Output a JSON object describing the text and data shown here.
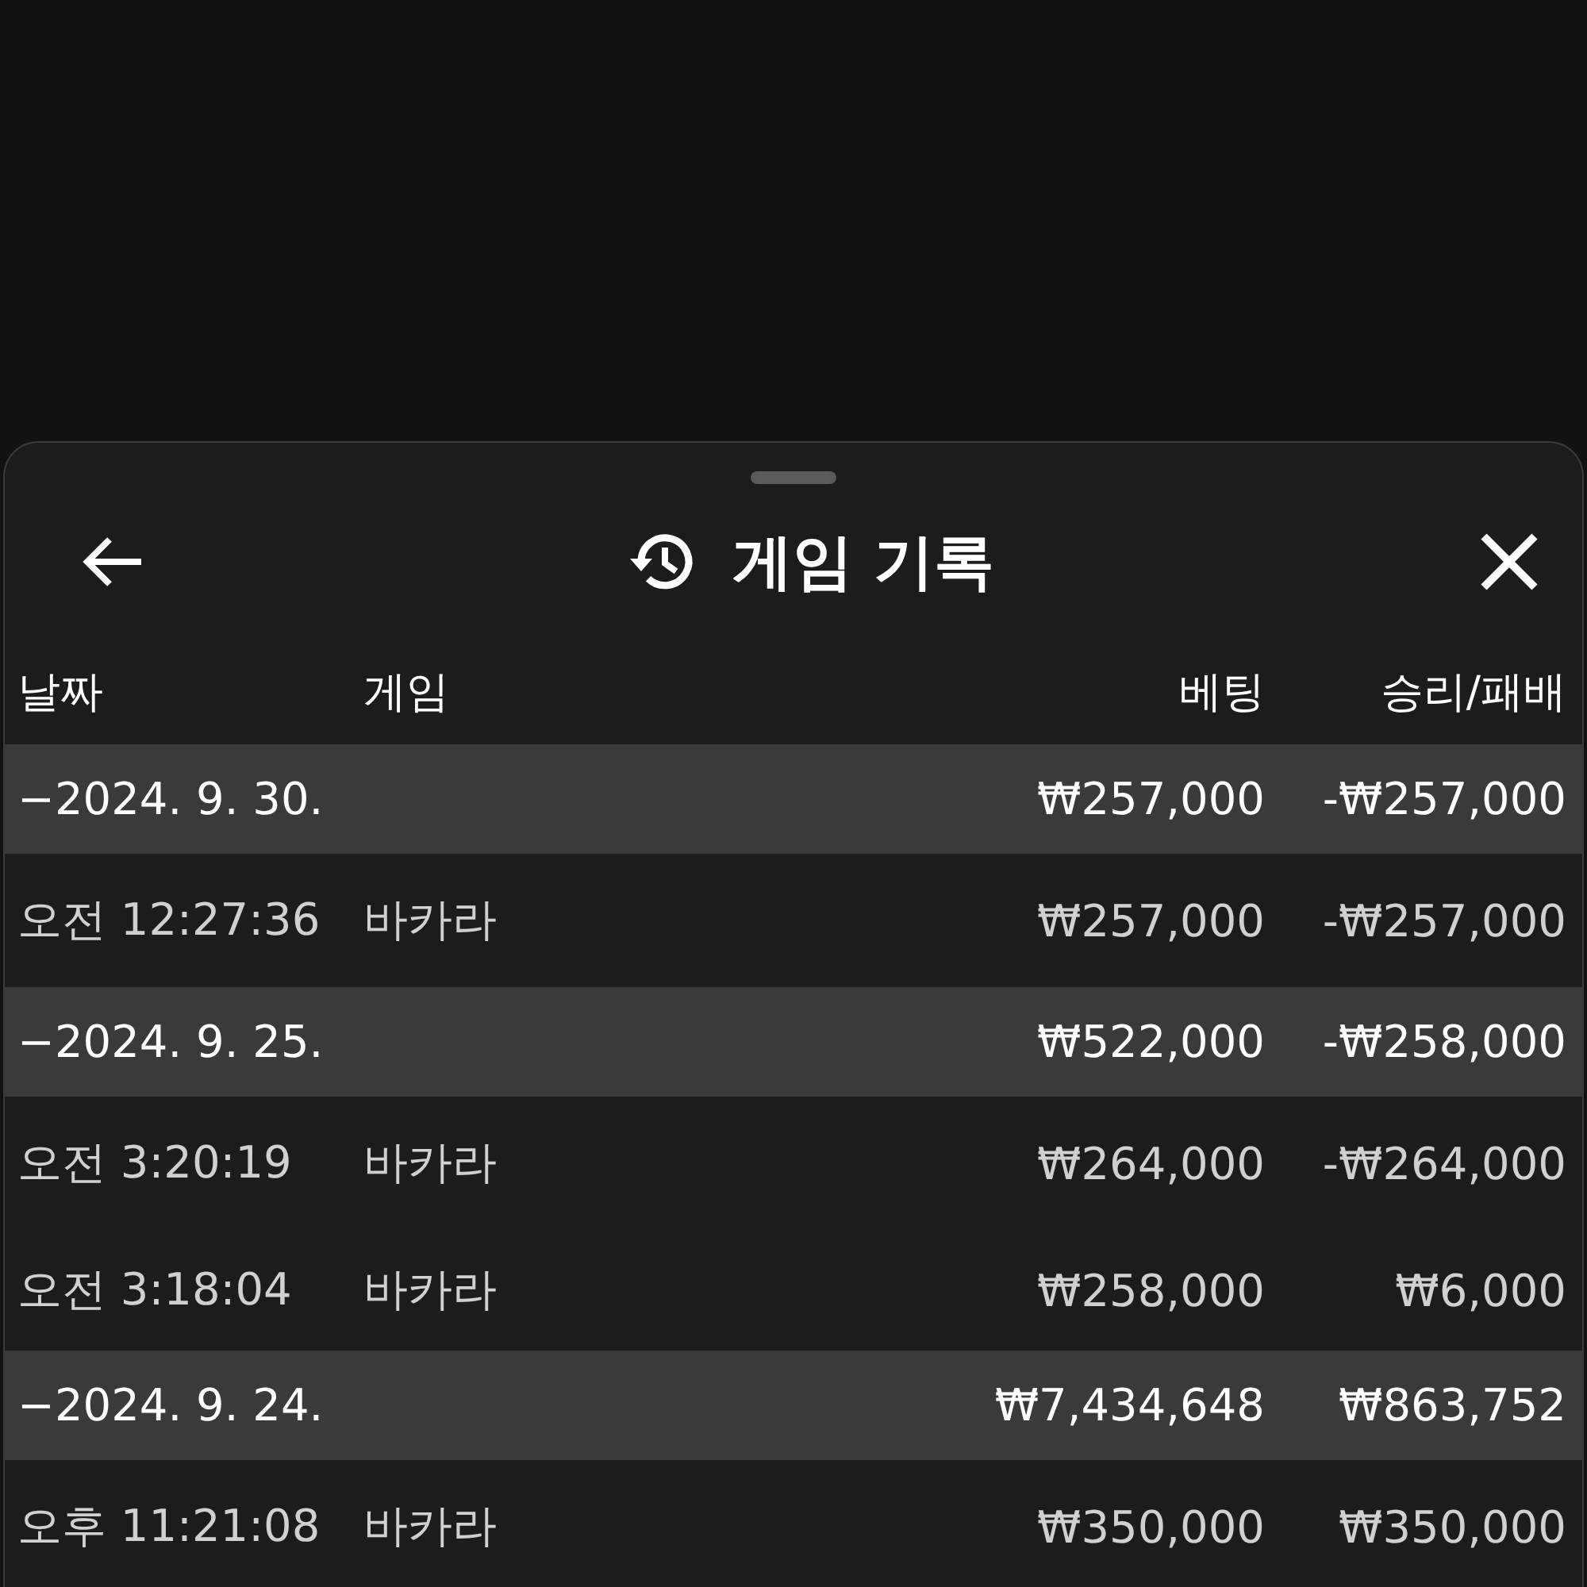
{
  "sheet": {
    "title": "게임 기록"
  },
  "columns": [
    "날짜",
    "게임",
    "베팅",
    "승리/패배"
  ],
  "groups": [
    {
      "date": "−2024. 9. 30.",
      "bet": "₩257,000",
      "result": "-₩257,000",
      "rows": [
        {
          "time": "오전 12:27:36",
          "game": "바카라",
          "bet": "₩257,000",
          "result": "-₩257,000"
        }
      ]
    },
    {
      "date": "−2024. 9. 25.",
      "bet": "₩522,000",
      "result": "-₩258,000",
      "rows": [
        {
          "time": "오전 3:20:19",
          "game": "바카라",
          "bet": "₩264,000",
          "result": "-₩264,000"
        },
        {
          "time": "오전 3:18:04",
          "game": "바카라",
          "bet": "₩258,000",
          "result": "₩6,000"
        }
      ]
    },
    {
      "date": "−2024. 9. 24.",
      "bet": "₩7,434,648",
      "result": "₩863,752",
      "rows": [
        {
          "time": "오후 11:21:08",
          "game": "바카라",
          "bet": "₩350,000",
          "result": "₩350,000"
        }
      ]
    }
  ]
}
